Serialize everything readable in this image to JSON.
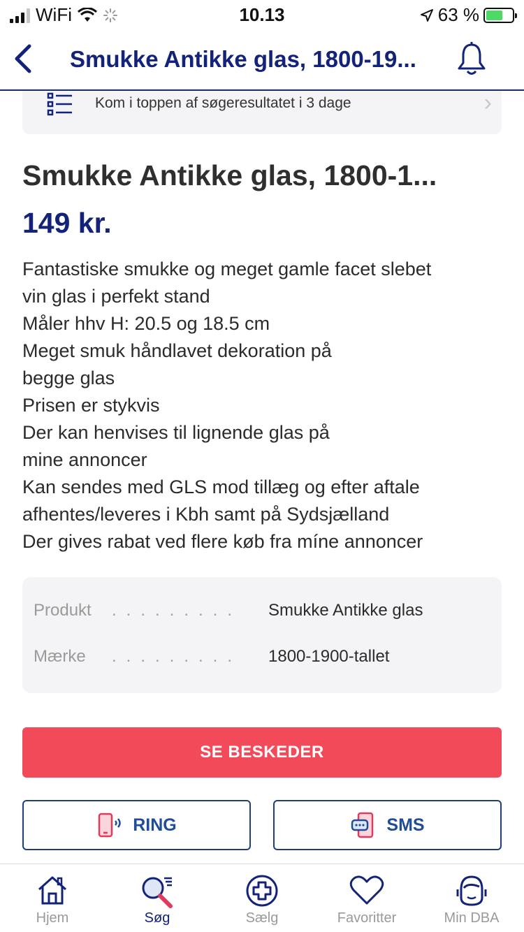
{
  "status_bar": {
    "carrier": "WiFi",
    "time": "10.13",
    "battery": "63 %"
  },
  "nav": {
    "title": "Smukke Antikke glas, 1800-19..."
  },
  "promo": {
    "text": "Kom i toppen af søgeresultatet i 3 dage"
  },
  "listing": {
    "title": "Smukke Antikke glas, 1800-1...",
    "price": "149 kr.",
    "description_lines": [
      "Fantastiske smukke og meget gamle facet slebet",
      "vin glas i perfekt stand",
      "Måler hhv H: 20.5 og 18.5 cm",
      "Meget smuk håndlavet dekoration på",
      "begge glas",
      "Prisen er stykvis",
      "Der kan henvises til lignende glas på",
      "mine annoncer",
      "Kan sendes med GLS mod tillæg og efter aftale",
      "afhentes/leveres i Kbh samt på Sydsjælland",
      "Der gives rabat ved flere køb fra míne annoncer"
    ]
  },
  "specs": [
    {
      "label": "Produkt",
      "value": "Smukke Antikke glas"
    },
    {
      "label": "Mærke",
      "value": "1800-1900-tallet"
    }
  ],
  "buttons": {
    "messages": "SE BESKEDER",
    "ring": "RING",
    "sms": "SMS"
  },
  "tabs": [
    {
      "label": "Hjem",
      "icon": "home-icon"
    },
    {
      "label": "Søg",
      "icon": "search-icon",
      "active": true
    },
    {
      "label": "Sælg",
      "icon": "plus-circle-icon"
    },
    {
      "label": "Favoritter",
      "icon": "heart-icon"
    },
    {
      "label": "Min DBA",
      "icon": "user-icon"
    }
  ],
  "colors": {
    "brand_navy": "#13237a",
    "primary_red": "#f34a5a",
    "outline_blue": "#1e3f7a"
  }
}
